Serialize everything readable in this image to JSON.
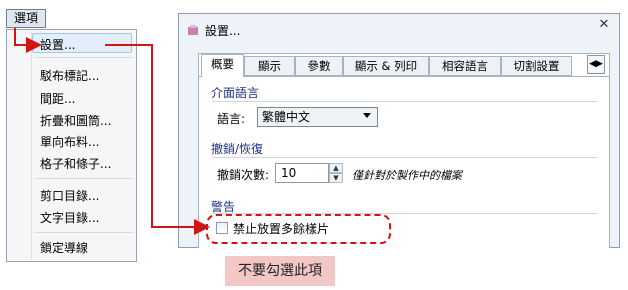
{
  "menu": {
    "title": "選項",
    "items": [
      {
        "label": "設置..."
      },
      {
        "label": "駁布標記..."
      },
      {
        "label": "間距..."
      },
      {
        "label": "折疊和圖筒..."
      },
      {
        "label": "單向布料..."
      },
      {
        "label": "格子和條子..."
      },
      {
        "label": "剪口目錄..."
      },
      {
        "label": "文字目錄..."
      },
      {
        "label": "鎖定導線"
      }
    ]
  },
  "dialog": {
    "title": "設置...",
    "close_glyph": "✕",
    "tabs": [
      "概要",
      "顯示",
      "參數",
      "顯示 & 列印",
      "相容語言",
      "切割設置"
    ],
    "tab_scroll_glyph": "◀▶",
    "interface_group": {
      "label": "介面語言",
      "language_label": "語言:",
      "language_value": "繁體中文"
    },
    "undo_group": {
      "label": "撤銷/恢復",
      "count_label": "撤銷次數:",
      "count_value": "10",
      "note": "僅針對於製作中的檔案"
    },
    "warning_group": {
      "label": "警告",
      "checkbox_label": "禁止放置多餘樣片"
    }
  },
  "annotation": {
    "tooltip": "不要勾選此項"
  },
  "colors": {
    "arrow": "#d21414",
    "group_label": "#1e3287",
    "tooltip_bg": "#f3c7c6"
  }
}
